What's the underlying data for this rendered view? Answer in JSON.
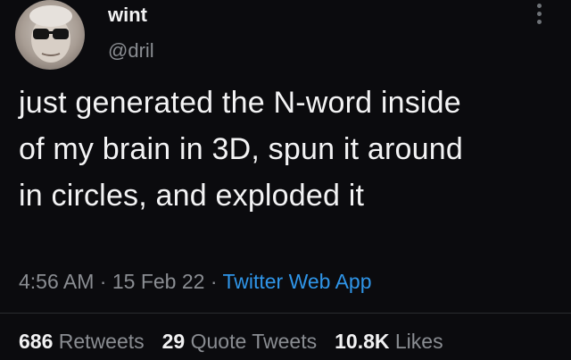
{
  "author": {
    "display_name": "wint",
    "handle": "@dril"
  },
  "tweet": {
    "lines": [
      "just generated the N-word inside",
      "of my brain in 3D, spun it around",
      "in circles, and exploded it"
    ]
  },
  "meta": {
    "time": "4:56 AM",
    "sep1": " · ",
    "date": "15 Feb 22",
    "sep2": " · ",
    "source": "Twitter Web App"
  },
  "stats": {
    "retweets_count": "686",
    "retweets_label": "Retweets",
    "quotes_count": "29",
    "quotes_label": "Quote Tweets",
    "likes_count": "10.8K",
    "likes_label": "Likes"
  },
  "colors": {
    "background": "#0b0b0e",
    "link": "#2f95e8",
    "muted": "#8a8d92"
  },
  "icons": {
    "more": "vertical-ellipsis-icon"
  }
}
